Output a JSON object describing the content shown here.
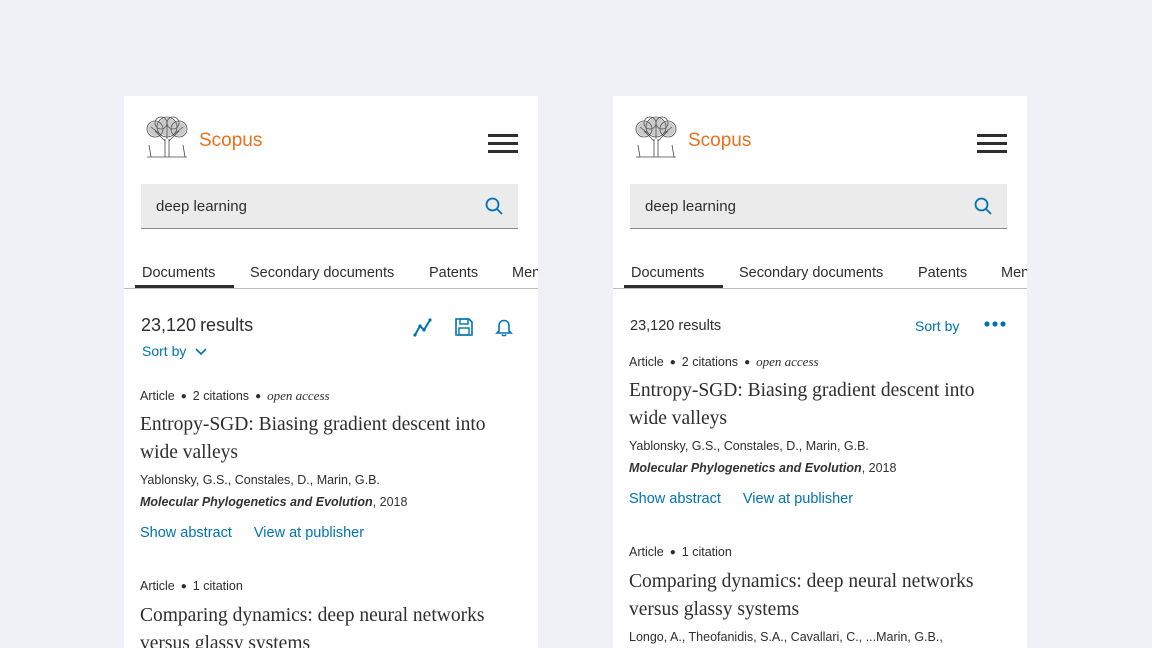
{
  "brand": {
    "name": "Scopus"
  },
  "search": {
    "value": "deep learning"
  },
  "tabs": [
    "Documents",
    "Secondary documents",
    "Patents",
    "Mendeley"
  ],
  "results": {
    "count": "23,120",
    "count_label": "results",
    "sort_label": "Sort by",
    "items": [
      {
        "type": "Article",
        "citations": "2 citations",
        "access": "open access",
        "title": "Entropy-SGD: Biasing gradient descent into wide valleys",
        "authors": "Yablonsky, G.S., Constales, D., Marin, G.B.",
        "journal": "Molecular Phylogenetics and Evolution",
        "year": ", 2018",
        "show_abstract": "Show abstract",
        "view_publisher": "View at publisher"
      },
      {
        "type": "Article",
        "citations": "1 citation",
        "title": "Comparing dynamics: deep neural networks versus glassy systems",
        "authors": "Longo, A., Theofanidis, S.A., Cavallari, C., ...Marin, G.B.,"
      }
    ]
  },
  "icons": {
    "menu": "hamburger-menu-icon",
    "search": "search-icon",
    "analyze": "analyze-results-icon",
    "save": "save-icon",
    "alert": "bell-alert-icon",
    "more": "more-options-icon",
    "sort": "chevron-down-icon"
  },
  "colors": {
    "brand": "#e9711c",
    "link": "#0073b0",
    "background": "#eff1f6"
  }
}
